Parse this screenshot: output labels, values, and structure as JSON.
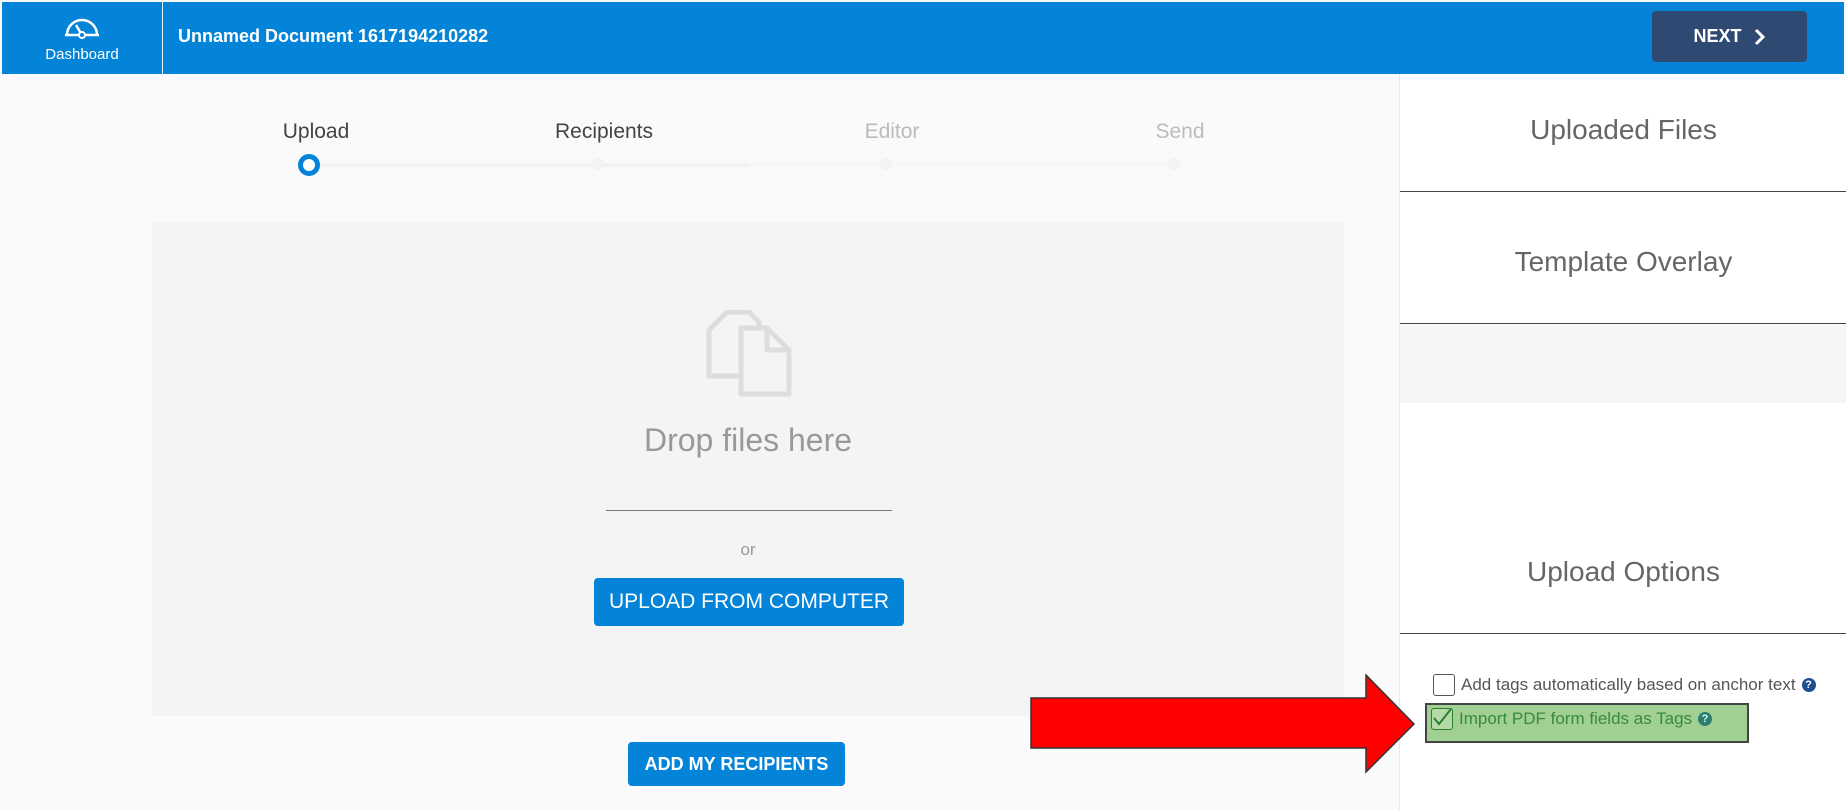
{
  "header": {
    "dashboard_label": "Dashboard",
    "doc_title": "Unnamed Document 1617194210282",
    "next_label": "NEXT"
  },
  "steps": [
    {
      "label": "Upload",
      "state": "active"
    },
    {
      "label": "Recipients",
      "state": "normal"
    },
    {
      "label": "Editor",
      "state": "disabled"
    },
    {
      "label": "Send",
      "state": "disabled"
    }
  ],
  "dropzone": {
    "drop_text": "Drop files here",
    "or_text": "or",
    "upload_label": "UPLOAD FROM COMPUTER"
  },
  "add_recipients_label": "ADD MY RECIPIENTS",
  "right_panel": {
    "uploaded_files": "Uploaded Files",
    "template_overlay": "Template Overlay",
    "upload_options": "Upload Options",
    "options": [
      {
        "label": "Add tags automatically based on anchor text",
        "checked": false
      },
      {
        "label": "Import PDF form fields as Tags",
        "checked": true
      }
    ],
    "help_glyph": "?"
  },
  "colors": {
    "primary": "#0484d8",
    "next_button": "#2e4a72",
    "highlight": "#78be64",
    "arrow": "#ff0000"
  },
  "icons": [
    "dashboard-gauge-icon",
    "chevron-right-icon",
    "files-icon",
    "help-icon",
    "checkmark-icon"
  ]
}
